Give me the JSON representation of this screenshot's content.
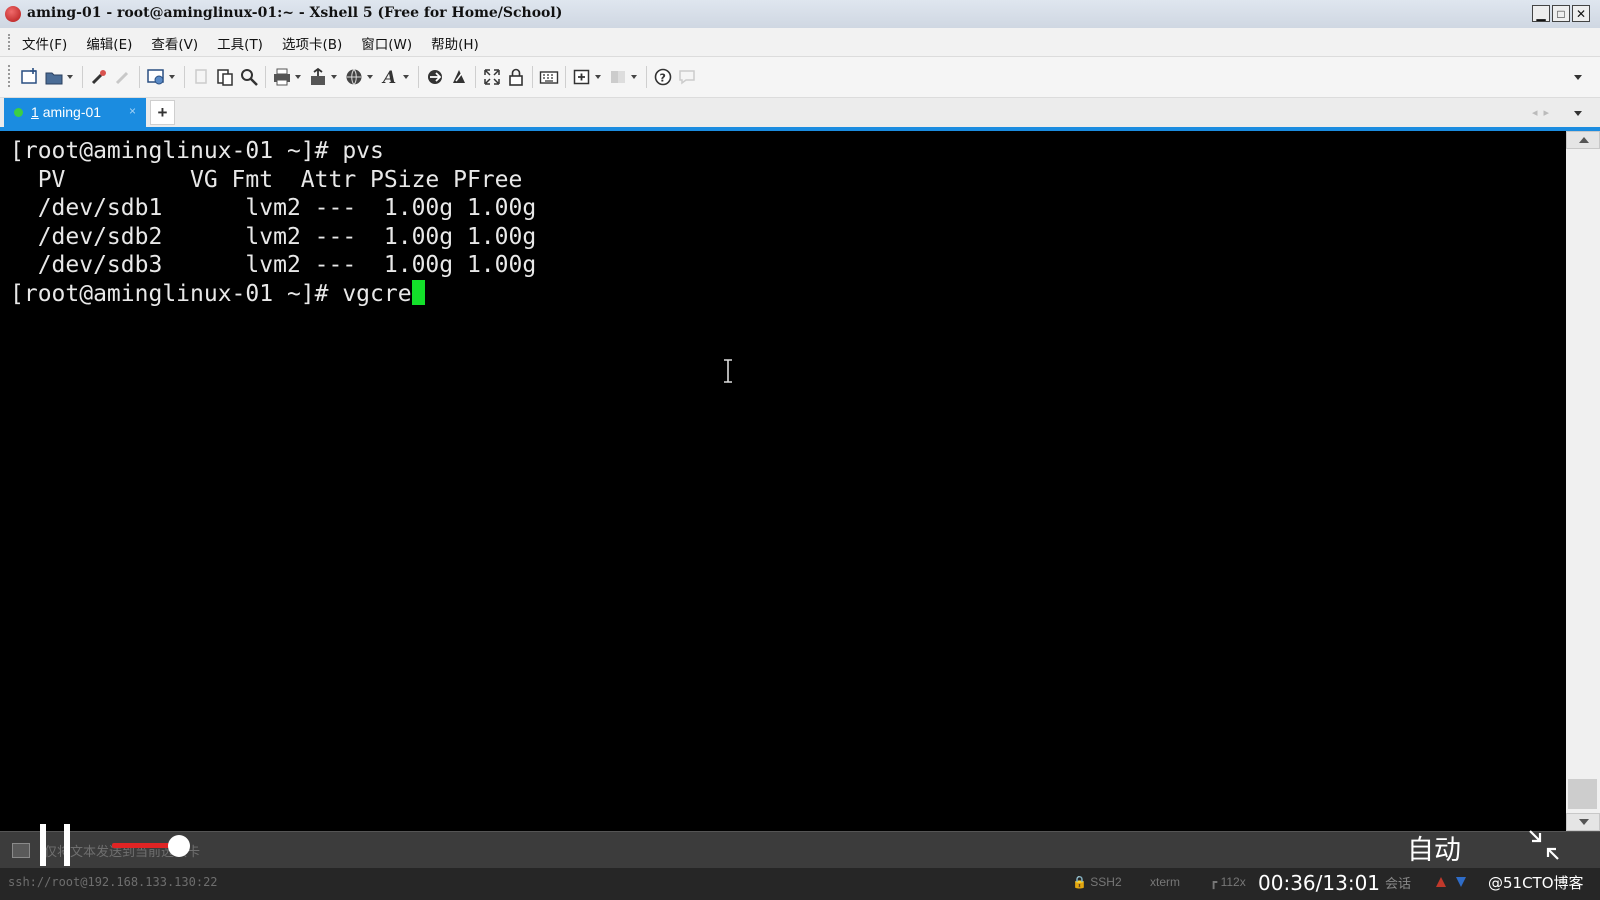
{
  "window": {
    "title": "aming-01 - root@aminglinux-01:~ - Xshell 5 (Free for Home/School)"
  },
  "menu": {
    "items": [
      {
        "label": "文件(F)"
      },
      {
        "label": "编辑(E)"
      },
      {
        "label": "查看(V)"
      },
      {
        "label": "工具(T)"
      },
      {
        "label": "选项卡(B)"
      },
      {
        "label": "窗口(W)"
      },
      {
        "label": "帮助(H)"
      }
    ]
  },
  "toolbar": {
    "icons": [
      "new-session-icon",
      "open-folder-icon",
      "reconnect-icon",
      "disconnect-icon",
      "properties-icon",
      "copy-icon",
      "paste-icon",
      "find-icon",
      "print-icon",
      "transfer-icon",
      "globe-icon",
      "font-icon",
      "xftp-icon",
      "xmanager-icon",
      "fullscreen-icon",
      "lock-icon",
      "keyboard-icon",
      "add-icon",
      "layout-icon",
      "help-icon",
      "chat-icon"
    ]
  },
  "tabs": [
    {
      "number": "1",
      "label": "aming-01",
      "status_color": "#3ccf43"
    }
  ],
  "terminal": {
    "lines": [
      "[root@aminglinux-01 ~]# pvs",
      "  PV         VG Fmt  Attr PSize PFree",
      "  /dev/sdb1      lvm2 ---  1.00g 1.00g",
      "  /dev/sdb2      lvm2 ---  1.00g 1.00g",
      "  /dev/sdb3      lvm2 ---  1.00g 1.00g"
    ],
    "current_prompt": "[root@aminglinux-01 ~]# vgcre",
    "cursor_color": "#13e02a"
  },
  "compose": {
    "placeholder": "仅将文本发送到当前选项卡"
  },
  "status": {
    "connection": "ssh://root@192.168.133.130:22",
    "protocol": "SSH2",
    "terminal_type": "xterm",
    "size": "112x",
    "sessions": "会话"
  },
  "player": {
    "current_time": "00:36",
    "duration": "13:01",
    "time_display": "00:36/13:01",
    "progress": 0.046,
    "quality_label": "自动",
    "watermark": "@51CTO博客"
  },
  "colors": {
    "accent": "#1b8ce0",
    "terminal_bg": "#000000",
    "progress": "#e02424"
  }
}
